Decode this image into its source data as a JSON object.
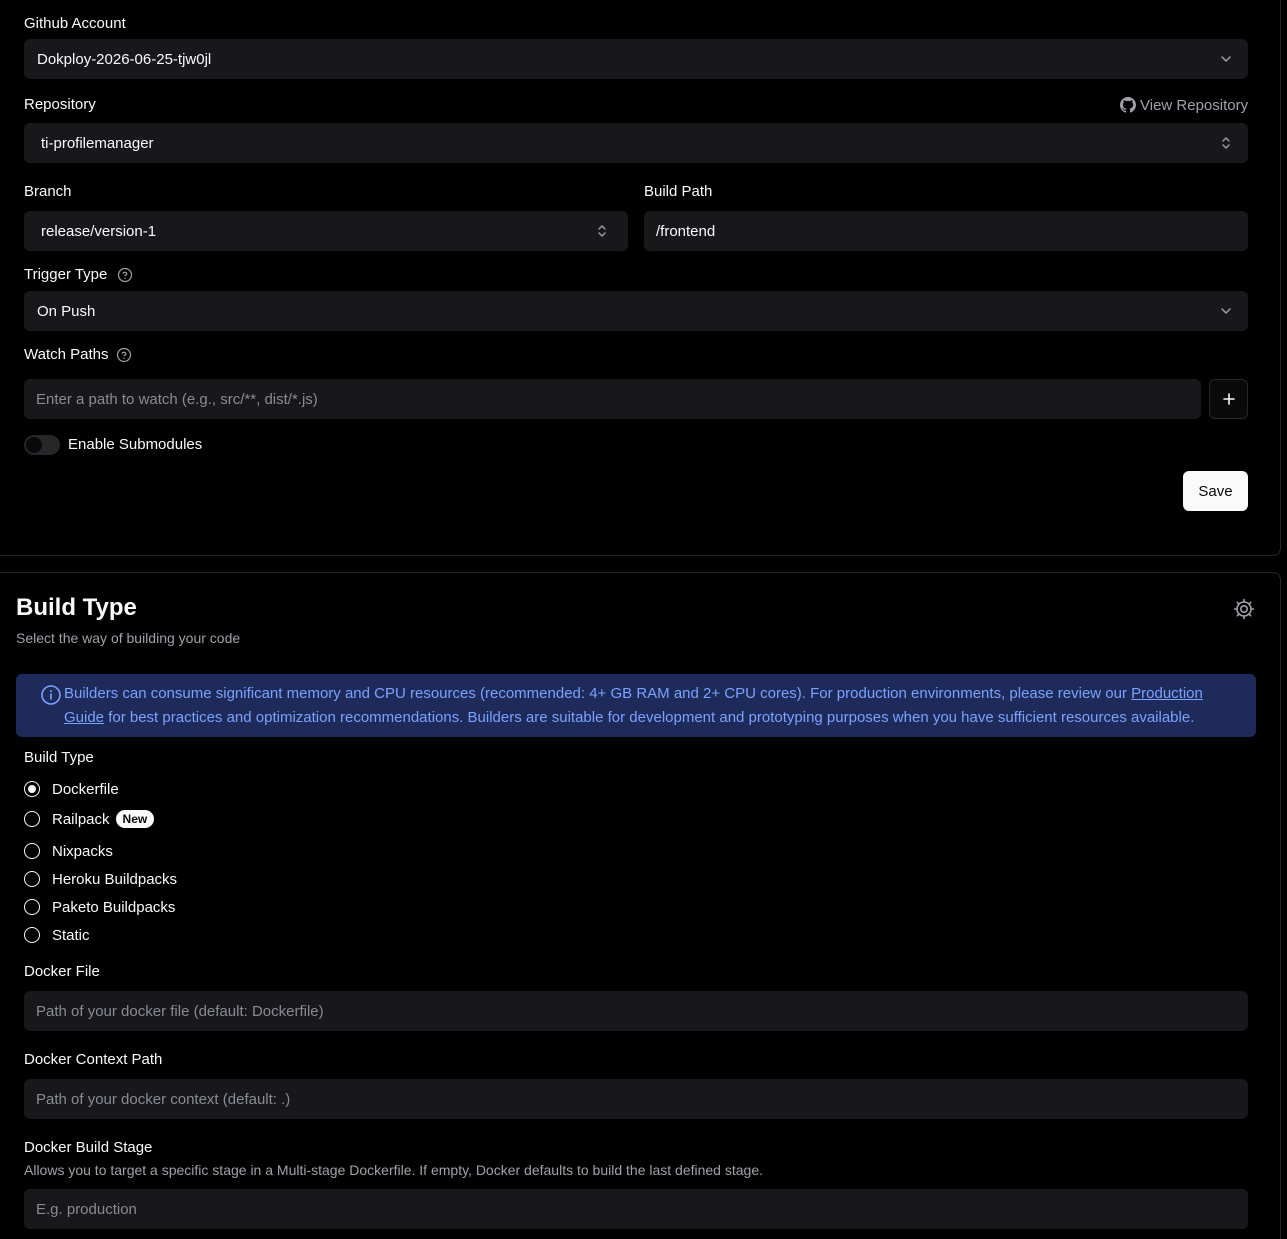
{
  "github": {
    "label": "Github Account",
    "value": "Dokploy-2026-06-25-tjw0jl"
  },
  "repository": {
    "label": "Repository",
    "value": "ti-profilemanager",
    "view_link": "View Repository"
  },
  "branch": {
    "label": "Branch",
    "value": "release/version-1"
  },
  "build_path": {
    "label": "Build Path",
    "value": "/frontend"
  },
  "trigger": {
    "label": "Trigger Type",
    "value": "On Push"
  },
  "watch_paths": {
    "label": "Watch Paths",
    "placeholder": "Enter a path to watch (e.g., src/**, dist/*.js)"
  },
  "submodules": {
    "label": "Enable Submodules",
    "enabled": false
  },
  "save_label": "Save",
  "build_section": {
    "title": "Build Type",
    "subtitle": "Select the way of building your code",
    "alert": {
      "text_before": "Builders can consume significant memory and CPU resources (recommended: 4+ GB RAM and 2+ CPU cores). For production environments, please review our ",
      "link": "Production Guide",
      "text_after": " for best practices and optimization recommendations. Builders are suitable for development and prototyping purposes when you have sufficient resources available."
    },
    "build_type_label": "Build Type",
    "options": [
      {
        "label": "Dockerfile",
        "checked": true
      },
      {
        "label": "Railpack",
        "badge": "New"
      },
      {
        "label": "Nixpacks"
      },
      {
        "label": "Heroku Buildpacks"
      },
      {
        "label": "Paketo Buildpacks"
      },
      {
        "label": "Static"
      }
    ],
    "docker_file": {
      "label": "Docker File",
      "placeholder": "Path of your docker file (default: Dockerfile)"
    },
    "docker_context": {
      "label": "Docker Context Path",
      "placeholder": "Path of your docker context (default: .)"
    },
    "docker_stage": {
      "label": "Docker Build Stage",
      "description": "Allows you to target a specific stage in a Multi-stage Dockerfile. If empty, Docker defaults to build the last defined stage.",
      "placeholder": "E.g. production"
    }
  }
}
